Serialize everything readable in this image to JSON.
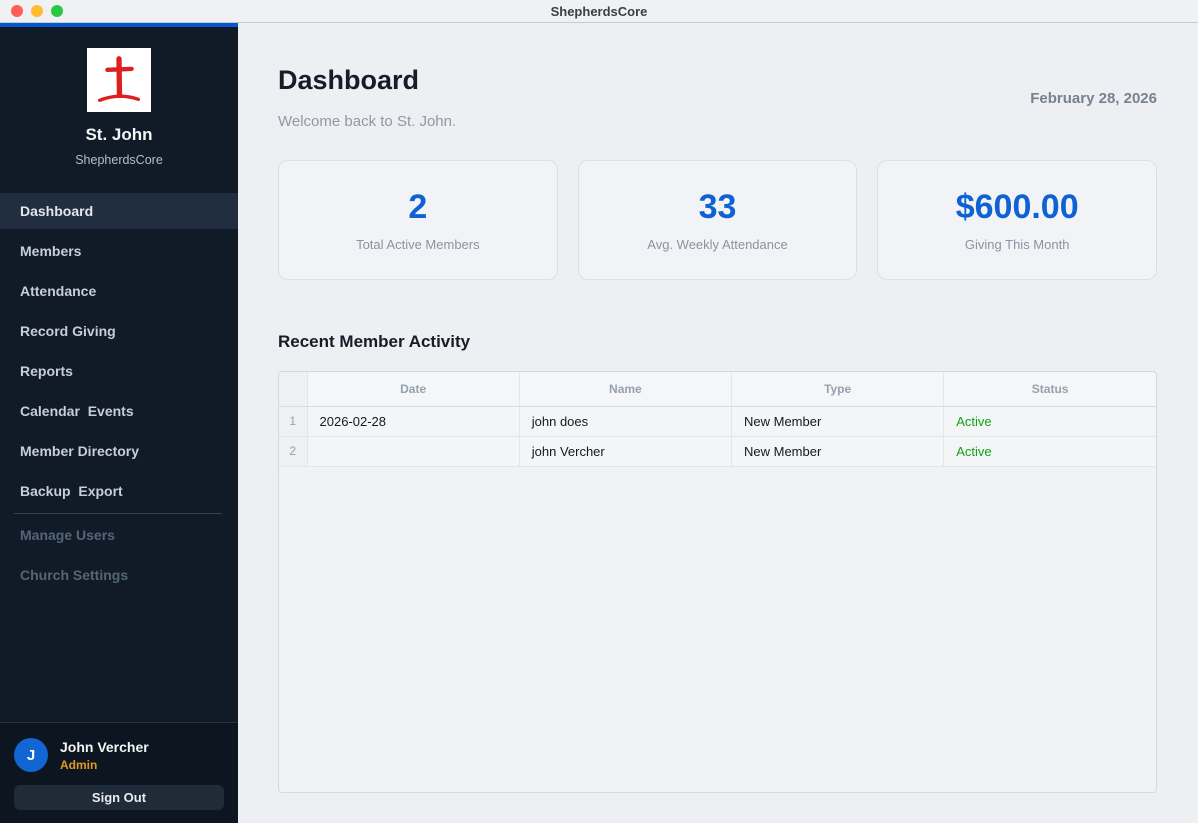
{
  "titlebar": {
    "title": "ShepherdsCore",
    "traffic_lights": [
      "close",
      "minimize",
      "zoom"
    ]
  },
  "sidebar": {
    "logo_icon": "red-cross-logo",
    "church_name": "St. John",
    "app_name": "ShepherdsCore",
    "nav_items": [
      {
        "label": "Dashboard",
        "active": true
      },
      {
        "label": "Members"
      },
      {
        "label": "Attendance"
      },
      {
        "label": "Record Giving"
      },
      {
        "label": "Reports"
      },
      {
        "label": "Calendar  Events"
      },
      {
        "label": "Member Directory"
      },
      {
        "label": "Backup  Export"
      },
      {
        "divider": true
      },
      {
        "label": "Manage Users",
        "disabled": true
      },
      {
        "label": "Church Settings",
        "disabled": true
      }
    ],
    "user": {
      "initial": "J",
      "name": "John Vercher",
      "role": "Admin"
    },
    "sign_out_label": "Sign Out"
  },
  "main": {
    "page_title": "Dashboard",
    "date": "February 28, 2026",
    "welcome": "Welcome back to St. John.",
    "stats": [
      {
        "value": "2",
        "label": "Total Active Members"
      },
      {
        "value": "33",
        "label": "Avg. Weekly Attendance"
      },
      {
        "value": "$600.00",
        "label": "Giving This Month"
      }
    ],
    "section_title": "Recent Member Activity",
    "table": {
      "columns": [
        "Date",
        "Name",
        "Type",
        "Status"
      ],
      "rows": [
        {
          "num": "1",
          "date": "2026-02-28",
          "name": "john does",
          "type": "New Member",
          "status": "Active"
        },
        {
          "num": "2",
          "date": "",
          "name": "john Vercher",
          "type": "New Member",
          "status": "Active"
        }
      ]
    }
  },
  "colors": {
    "accent_blue": "#0f62d4",
    "titlebar_accent_line": "#0559cf",
    "sidebar_bg": "#111a27",
    "sidebar_active_bg": "#202e40",
    "status_green": "#14a014",
    "role_orange": "#df9b25",
    "logo_red": "#dd1f1f"
  }
}
